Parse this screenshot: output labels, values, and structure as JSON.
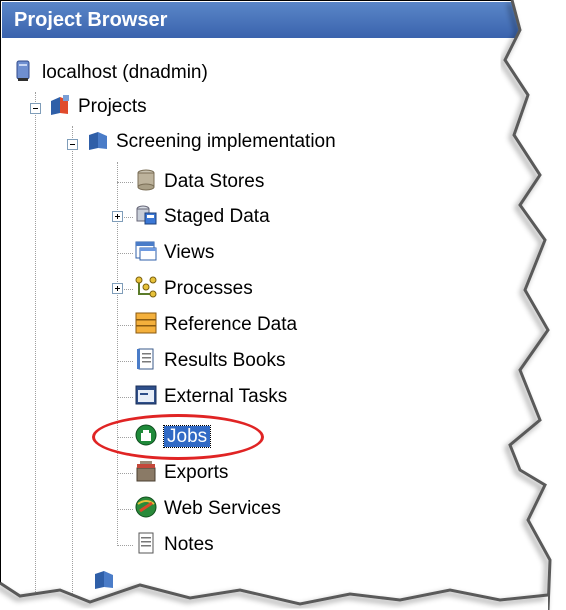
{
  "panel": {
    "title": "Project Browser"
  },
  "tree": {
    "server": "localhost (dnadmin)",
    "projects": "Projects",
    "project": "Screening implementation",
    "items": [
      {
        "label": "Data Stores",
        "icon": "database-icon"
      },
      {
        "label": "Staged Data",
        "icon": "staged-data-icon"
      },
      {
        "label": "Views",
        "icon": "views-icon"
      },
      {
        "label": "Processes",
        "icon": "processes-icon"
      },
      {
        "label": "Reference Data",
        "icon": "reference-data-icon"
      },
      {
        "label": "Results Books",
        "icon": "results-book-icon"
      },
      {
        "label": "External Tasks",
        "icon": "external-tasks-icon"
      },
      {
        "label": "Jobs",
        "icon": "jobs-icon"
      },
      {
        "label": "Exports",
        "icon": "exports-icon"
      },
      {
        "label": "Web Services",
        "icon": "web-services-icon"
      },
      {
        "label": "Notes",
        "icon": "notes-icon"
      }
    ],
    "selected": "Jobs"
  },
  "colors": {
    "title_bg": "#3a63ad",
    "selection": "#316ac5",
    "highlight_ring": "#e02424"
  }
}
